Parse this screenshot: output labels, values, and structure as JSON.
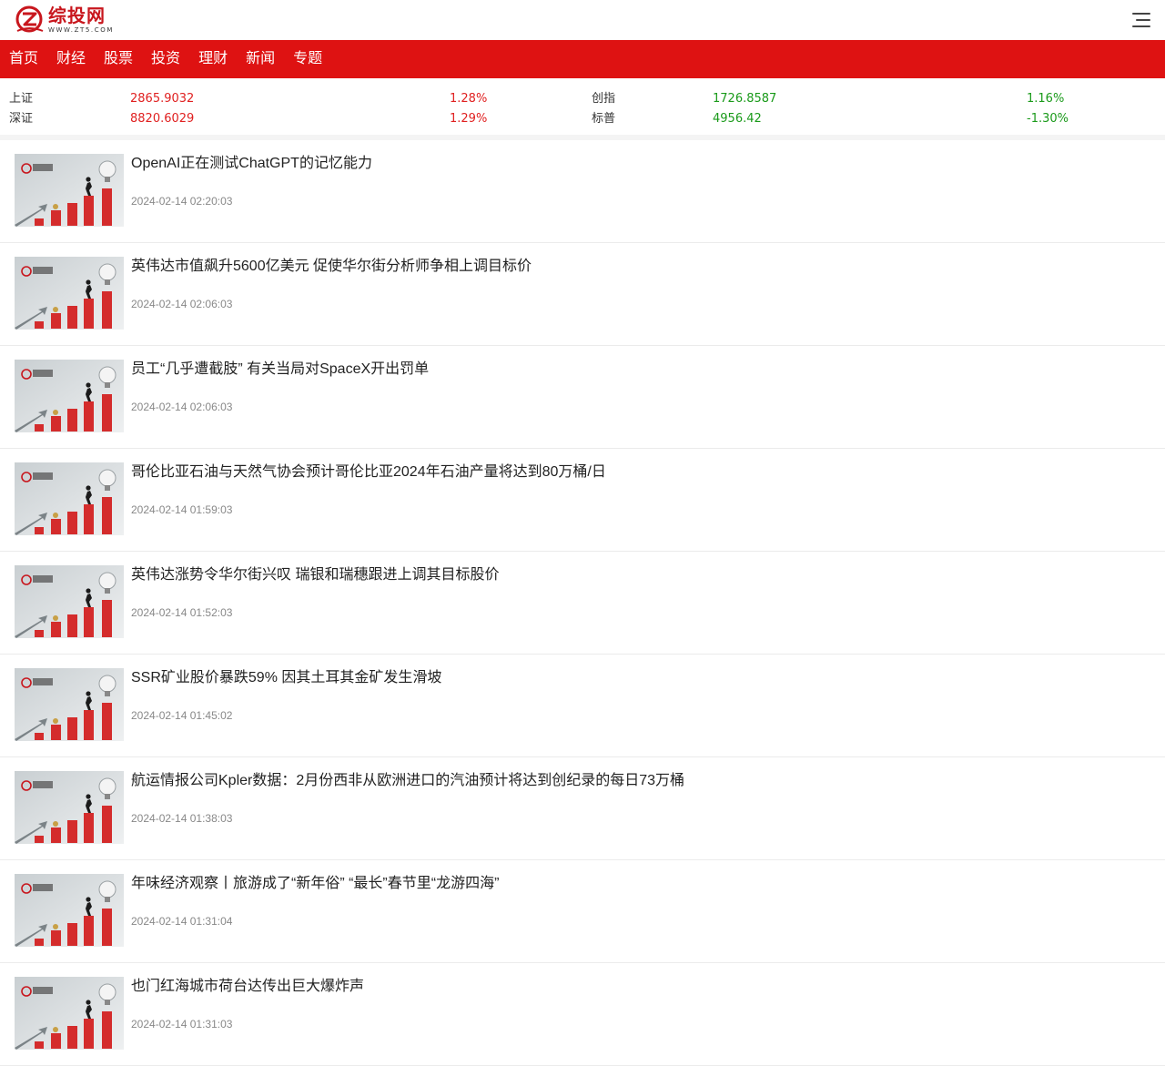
{
  "header": {
    "logo_cn": "综投网",
    "logo_en": "WWW.ZT5.COM",
    "menu_icon": "hamburger-menu-icon",
    "brand_color": "#c8161d"
  },
  "nav": {
    "background": "#de1212",
    "items": [
      {
        "label": "首页"
      },
      {
        "label": "财经"
      },
      {
        "label": "股票"
      },
      {
        "label": "投资"
      },
      {
        "label": "理财"
      },
      {
        "label": "新闻"
      },
      {
        "label": "专题"
      }
    ]
  },
  "indices": [
    {
      "name": "上证",
      "value": "2865.9032",
      "change": "1.28%",
      "name2": "创指",
      "value2": "1726.8587",
      "change2": "1.16%"
    },
    {
      "name": "深证",
      "value": "8820.6029",
      "change": "1.29%",
      "name2": "标普",
      "value2": "4956.42",
      "change2": "-1.30%"
    }
  ],
  "colors": {
    "up": "#e02020",
    "green": "#1a9a1a"
  },
  "news": [
    {
      "title": "OpenAI正在测试ChatGPT的记忆能力",
      "time": "2024-02-14 02:20:03"
    },
    {
      "title": "英伟达市值飙升5600亿美元 促使华尔街分析师争相上调目标价",
      "time": "2024-02-14 02:06:03"
    },
    {
      "title": "员工“几乎遭截肢” 有关当局对SpaceX开出罚单",
      "time": "2024-02-14 02:06:03"
    },
    {
      "title": "哥伦比亚石油与天然气协会预计哥伦比亚2024年石油产量将达到80万桶/日",
      "time": "2024-02-14 01:59:03"
    },
    {
      "title": "英伟达涨势令华尔街兴叹 瑞银和瑞穗跟进上调其目标股价",
      "time": "2024-02-14 01:52:03"
    },
    {
      "title": "SSR矿业股价暴跌59% 因其土耳其金矿发生滑坡",
      "time": "2024-02-14 01:45:02"
    },
    {
      "title": "航运情报公司Kpler数据：2月份西非从欧洲进口的汽油预计将达到创纪录的每日73万桶",
      "time": "2024-02-14 01:38:03"
    },
    {
      "title": "年味经济观察丨旅游成了“新年俗” “最长”春节里“龙游四海”",
      "time": "2024-02-14 01:31:04"
    },
    {
      "title": "也门红海城市荷台达传出巨大爆炸声",
      "time": "2024-02-14 01:31:03"
    }
  ]
}
